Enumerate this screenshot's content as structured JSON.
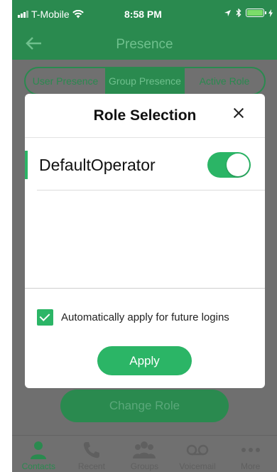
{
  "status_bar": {
    "carrier": "T-Mobile",
    "time": "8:58 PM"
  },
  "nav": {
    "title": "Presence"
  },
  "segments": [
    {
      "label": "User Presence",
      "active": false
    },
    {
      "label": "Group Presence",
      "active": true
    },
    {
      "label": "Active Role",
      "active": false
    }
  ],
  "modal": {
    "title": "Role Selection",
    "roles": [
      {
        "name": "DefaultOperator",
        "enabled": true
      }
    ],
    "auto_apply_label": "Automatically apply for future logins",
    "auto_apply_checked": true,
    "apply_label": "Apply"
  },
  "background_button": {
    "label": "Change Role"
  },
  "tabs": [
    {
      "label": "Contacts",
      "icon": "person-icon",
      "active": true
    },
    {
      "label": "Recent",
      "icon": "phone-icon",
      "active": false
    },
    {
      "label": "Groups",
      "icon": "group-icon",
      "active": false
    },
    {
      "label": "Voicemail",
      "icon": "voicemail-icon",
      "active": false
    },
    {
      "label": "More",
      "icon": "more-icon",
      "active": false
    }
  ],
  "colors": {
    "accent": "#2bb566",
    "dim_header": "#2a8a4f"
  }
}
